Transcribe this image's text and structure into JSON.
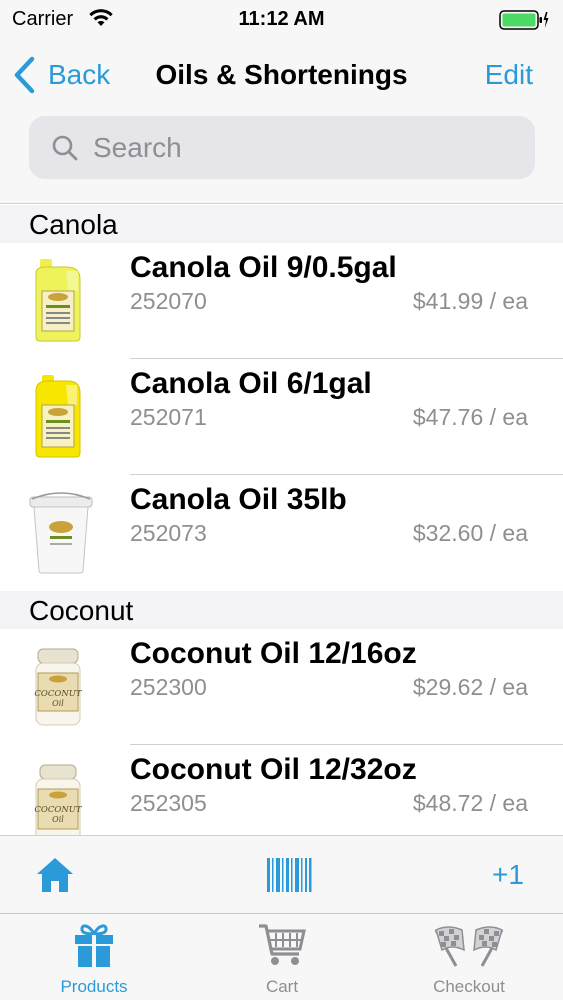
{
  "status_bar": {
    "carrier": "Carrier",
    "time": "11:12 AM"
  },
  "nav": {
    "back_label": "Back",
    "title": "Oils & Shortenings",
    "edit_label": "Edit"
  },
  "search": {
    "placeholder": "Search"
  },
  "sections": [
    {
      "header": "Canola",
      "items": [
        {
          "name": "Canola Oil 9/0.5gal",
          "sku": "252070",
          "price": "$41.99 / ea",
          "image": "canola-jug-small-icon"
        },
        {
          "name": "Canola Oil 6/1gal",
          "sku": "252071",
          "price": "$47.76 / ea",
          "image": "canola-jug-large-icon"
        },
        {
          "name": "Canola Oil 35lb",
          "sku": "252073",
          "price": "$32.60 / ea",
          "image": "pail-icon"
        }
      ]
    },
    {
      "header": "Coconut",
      "items": [
        {
          "name": "Coconut Oil 12/16oz",
          "sku": "252300",
          "price": "$29.62 / ea",
          "image": "coconut-jar-icon"
        },
        {
          "name": "Coconut Oil 12/32oz",
          "sku": "252305",
          "price": "$48.72 / ea",
          "image": "coconut-jar-icon"
        }
      ]
    }
  ],
  "action_bar": {
    "home_icon": "home-icon",
    "scan_icon": "barcode-icon",
    "plus_label": "+1"
  },
  "tabs": [
    {
      "label": "Products",
      "icon": "gift-icon",
      "active": true
    },
    {
      "label": "Cart",
      "icon": "cart-icon",
      "active": false
    },
    {
      "label": "Checkout",
      "icon": "checkered-flags-icon",
      "active": false
    }
  ],
  "colors": {
    "accent": "#2a9bd8",
    "inactive": "#8e8e93",
    "battery": "#4cd964"
  }
}
